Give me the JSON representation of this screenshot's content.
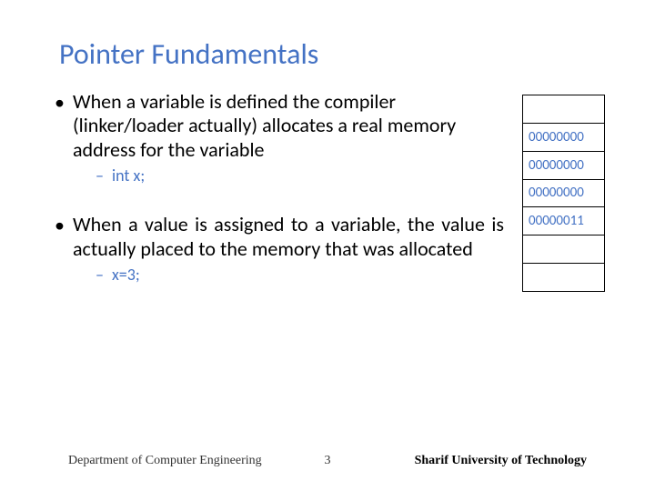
{
  "title": "Pointer Fundamentals",
  "bullets": [
    {
      "text": "When a variable is defined the compiler (linker/loader actually) allocates a real memory address for the variable",
      "sub": [
        "int x;"
      ]
    },
    {
      "text": "When a value is assigned to a variable, the value is actually placed to the memory that was allocated",
      "sub": [
        "x=3;"
      ]
    }
  ],
  "memory_cells": [
    "",
    "00000000",
    "00000000",
    "00000000",
    "00000011",
    "",
    ""
  ],
  "footer": {
    "left": "Department of Computer Engineering",
    "center": "3",
    "right": "Sharif University of Technology"
  }
}
